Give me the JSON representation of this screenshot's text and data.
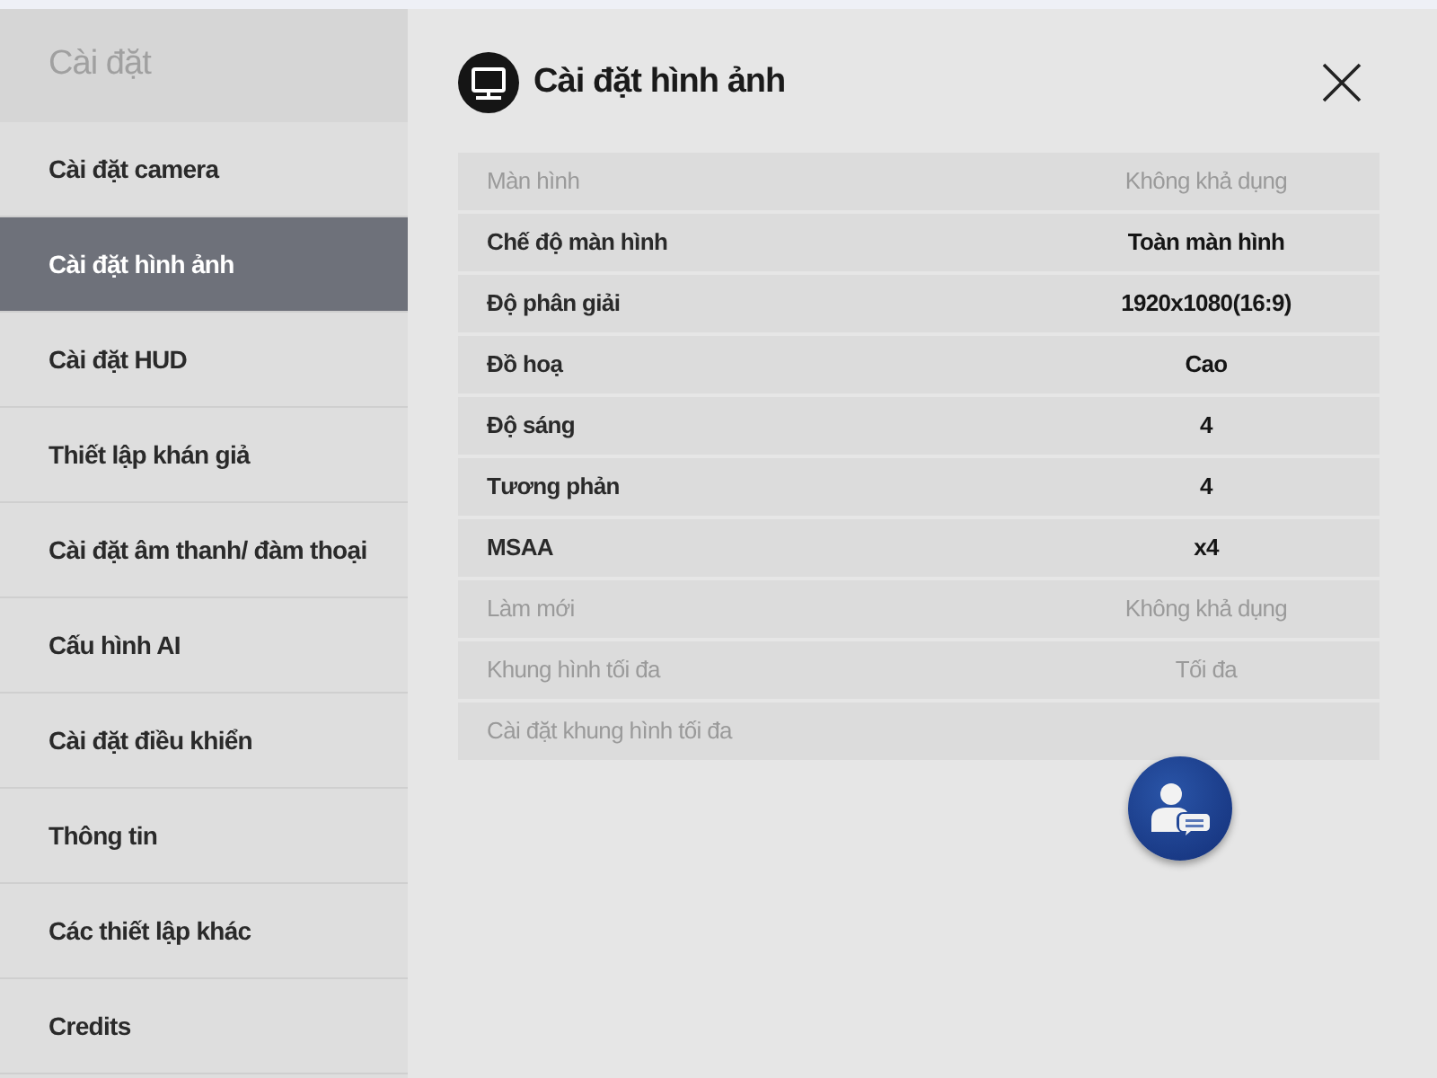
{
  "sidebar": {
    "title": "Cài đặt",
    "items": [
      {
        "label": "Cài đặt camera",
        "selected": false
      },
      {
        "label": "Cài đặt hình ảnh",
        "selected": true
      },
      {
        "label": "Cài đặt HUD",
        "selected": false
      },
      {
        "label": "Thiết lập khán giả",
        "selected": false
      },
      {
        "label": "Cài đặt âm thanh/ đàm thoại",
        "selected": false
      },
      {
        "label": "Cấu hình AI",
        "selected": false
      },
      {
        "label": "Cài đặt điều khiển",
        "selected": false
      },
      {
        "label": "Thông tin",
        "selected": false
      },
      {
        "label": "Các thiết lập khác",
        "selected": false
      },
      {
        "label": "Credits",
        "selected": false
      }
    ]
  },
  "panel": {
    "title": "Cài đặt hình ảnh",
    "settings": [
      {
        "label": "Màn hình",
        "value": "Không khả dụng",
        "disabled": true
      },
      {
        "label": "Chế độ màn hình",
        "value": "Toàn màn hình",
        "disabled": false
      },
      {
        "label": "Độ phân giải",
        "value": "1920x1080(16:9)",
        "disabled": false
      },
      {
        "label": "Đồ hoạ",
        "value": "Cao",
        "disabled": false
      },
      {
        "label": "Độ sáng",
        "value": "4",
        "disabled": false
      },
      {
        "label": "Tương phản",
        "value": "4",
        "disabled": false
      },
      {
        "label": "MSAA",
        "value": "x4",
        "disabled": false
      },
      {
        "label": "Làm mới",
        "value": "Không khả dụng",
        "disabled": true
      },
      {
        "label": "Khung hình tối đa",
        "value": "Tối đa",
        "disabled": true
      },
      {
        "label": "Cài đặt khung hình tối đa",
        "disabled": true
      }
    ]
  }
}
